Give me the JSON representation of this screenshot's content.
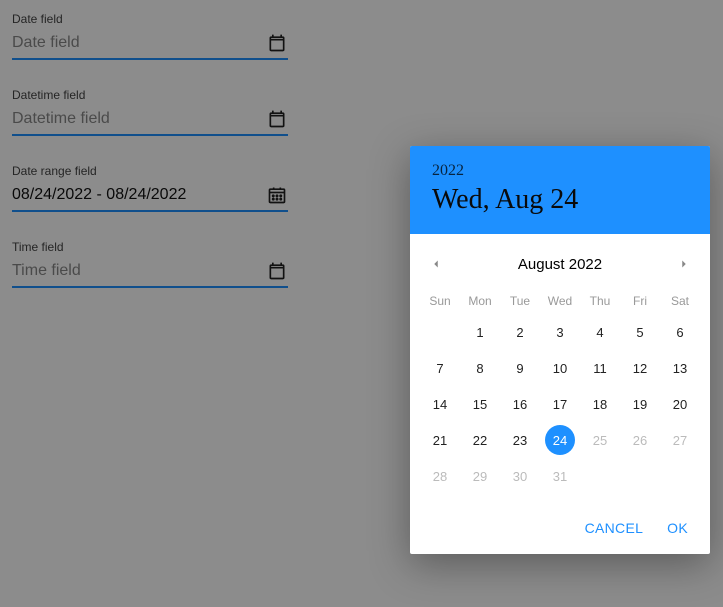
{
  "fields": {
    "date": {
      "label": "Date field",
      "placeholder": "Date field",
      "value": ""
    },
    "datetime": {
      "label": "Datetime field",
      "placeholder": "Datetime field",
      "value": ""
    },
    "daterange": {
      "label": "Date range field",
      "placeholder": "",
      "value": "08/24/2022 - 08/24/2022"
    },
    "time": {
      "label": "Time field",
      "placeholder": "Time field",
      "value": ""
    }
  },
  "picker": {
    "year": "2022",
    "dateText": "Wed, Aug 24",
    "monthTitle": "August 2022",
    "weekdays": [
      "Sun",
      "Mon",
      "Tue",
      "Wed",
      "Thu",
      "Fri",
      "Sat"
    ],
    "weeks": [
      [
        {
          "n": "",
          "t": "blank"
        },
        {
          "n": "1",
          "t": "in"
        },
        {
          "n": "2",
          "t": "in"
        },
        {
          "n": "3",
          "t": "in"
        },
        {
          "n": "4",
          "t": "in"
        },
        {
          "n": "5",
          "t": "in"
        },
        {
          "n": "6",
          "t": "in"
        }
      ],
      [
        {
          "n": "7",
          "t": "in"
        },
        {
          "n": "8",
          "t": "in"
        },
        {
          "n": "9",
          "t": "in"
        },
        {
          "n": "10",
          "t": "in"
        },
        {
          "n": "11",
          "t": "in"
        },
        {
          "n": "12",
          "t": "in"
        },
        {
          "n": "13",
          "t": "in"
        }
      ],
      [
        {
          "n": "14",
          "t": "in"
        },
        {
          "n": "15",
          "t": "in"
        },
        {
          "n": "16",
          "t": "in"
        },
        {
          "n": "17",
          "t": "in"
        },
        {
          "n": "18",
          "t": "in"
        },
        {
          "n": "19",
          "t": "in"
        },
        {
          "n": "20",
          "t": "in"
        }
      ],
      [
        {
          "n": "21",
          "t": "in"
        },
        {
          "n": "22",
          "t": "in"
        },
        {
          "n": "23",
          "t": "in"
        },
        {
          "n": "24",
          "t": "sel"
        },
        {
          "n": "25",
          "t": "out"
        },
        {
          "n": "26",
          "t": "out"
        },
        {
          "n": "27",
          "t": "out"
        }
      ],
      [
        {
          "n": "28",
          "t": "out"
        },
        {
          "n": "29",
          "t": "out"
        },
        {
          "n": "30",
          "t": "out"
        },
        {
          "n": "31",
          "t": "out"
        },
        {
          "n": "",
          "t": "blank"
        },
        {
          "n": "",
          "t": "blank"
        },
        {
          "n": "",
          "t": "blank"
        }
      ]
    ],
    "actions": {
      "cancel": "CANCEL",
      "ok": "OK"
    }
  }
}
